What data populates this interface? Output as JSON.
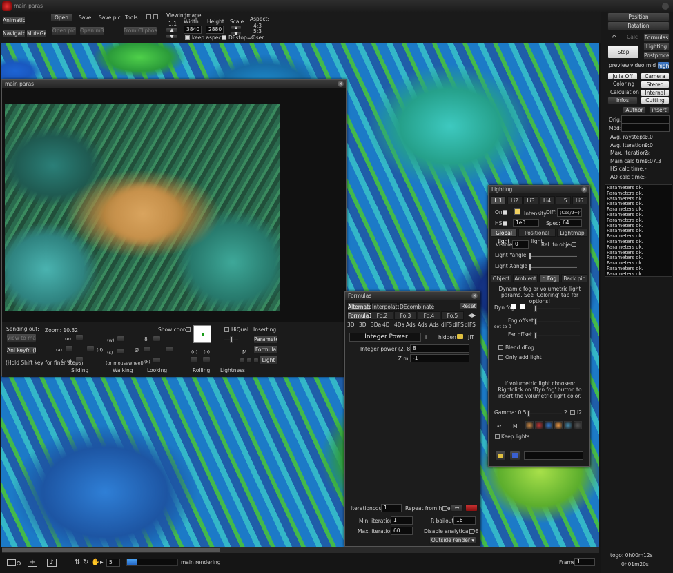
{
  "app_title": "main paras",
  "toolbar": {
    "animations": "Animations",
    "navigator": "Navigator",
    "mutagen": "MutaGen",
    "open": "Open",
    "save": "Save",
    "save_pic": "Save pic",
    "tools": "Tools",
    "open_pic": "Open pic",
    "open_m3p": "Open m3p",
    "from_clipboard": "From Clipboard",
    "viewing_label": "Viewing",
    "viewing_value": "1:1",
    "image_label": "Image",
    "width_label": "Width:",
    "width_value": "3840",
    "height_label": "Height:",
    "height_value": "2880",
    "scale_label": "Scale",
    "aspect_label": "Aspect:",
    "aspect_1": "4:3",
    "aspect_2": "5:3",
    "aspect_3": "user",
    "keep_aspect": "keep aspect",
    "destop": "DEstop=C"
  },
  "right_panel": {
    "position": "Position",
    "rotation": "Rotation",
    "calc": "Calc",
    "formulas": "Formulas",
    "stop": "Stop",
    "lighting": "Lighting",
    "postprocess": "Postprocess",
    "preview": "preview",
    "video": "video",
    "mid": "mid",
    "high": "high",
    "julia_off": "Julia Off",
    "camera": "Camera",
    "coloring": "Coloring",
    "stereo": "Stereo",
    "calculation": "Calculation",
    "internal": "Internal",
    "infos": "Infos",
    "cutting": "Cutting",
    "author": "Author",
    "insert": "insert",
    "orig": "Orig:",
    "mod": "Mod:",
    "stats": [
      {
        "label": "Avg. raysteps:",
        "value": "0.0"
      },
      {
        "label": "Avg. iterations:",
        "value": "0.0"
      },
      {
        "label": "Max. iterations:",
        "value": "?"
      },
      {
        "label": "Main calc time:",
        "value": "0.07.3"
      },
      {
        "label": "HS calc time:",
        "value": "-"
      },
      {
        "label": "AO calc time:",
        "value": "-"
      }
    ],
    "log_line": "Parameters ok.",
    "log_count": 17,
    "togo": "togo: 0h00m12s",
    "elapsed": "0h01m20s"
  },
  "main_paras": {
    "title": "main paras",
    "sending_out": "Sending out:",
    "view_to_main": "View to main",
    "ani_keyfr": "Ani keyfr. (f)",
    "hold_shift": "(Hold Shift key for finer steps)",
    "zoom": "Zoom: 10.32",
    "show_coords": "Show coords",
    "hiqual": "HiQual",
    "inserting": "Inserting:",
    "parameter": "Parameter",
    "formula": "Formula",
    "light": "Light",
    "sliding": "Sliding",
    "walking": "Walking",
    "looking": "Looking",
    "rolling": "Rolling",
    "lightness": "Lightness",
    "or_mousewheel": "(or mousewheel)",
    "keys": {
      "e": "(e)",
      "a": "(a)",
      "d": "(d)",
      "cq": "(c,q)",
      "w": "(w)",
      "s": "(s)",
      "k": "(k)",
      "u": "(u)",
      "o": "(o)",
      "m": "M"
    }
  },
  "formulas": {
    "title": "Formulas",
    "alternate": "Alternate",
    "interpolate": "Interpolate",
    "decombinate": "DEcombinate",
    "reset": "Reset",
    "tabs": [
      "Formula1",
      "Fo.2",
      "Fo.3",
      "Fo.4",
      "Fo.5"
    ],
    "dim_tabs": [
      "3D",
      "3D",
      "3Da",
      "4D",
      "4Da",
      "Ads",
      "Ads",
      "Ads",
      "dIFS",
      "dIFS",
      "dIFS"
    ],
    "formula_name": "Integer Power",
    "info": "i",
    "hidden": "hidden",
    "jit": "JIT",
    "params": [
      {
        "label": "Integer power (2, 8)",
        "value": "8"
      },
      {
        "label": "Z multiplier",
        "value": "-1"
      }
    ],
    "iterationcount": "Iterationcount",
    "iterationcount_value": "1",
    "repeat_from_here": "Repeat from here",
    "min_iter": "Min. iterations:",
    "min_iter_value": "1",
    "max_iter": "Max. iterations:",
    "max_iter_value": "60",
    "r_bailout": "R bailout:",
    "r_bailout_value": "16",
    "disable_de": "Disable analytical DE",
    "outside_render": "Outside render"
  },
  "lighting": {
    "title": "Lighting",
    "light_tabs": [
      "Li1",
      "Li2",
      "Li3",
      "Li4",
      "Li5",
      "Li6"
    ],
    "on": "On",
    "intensity": "Intensity",
    "diff": "Diff:",
    "diff_value": "(Cos/2+)^",
    "hs": "HS",
    "hs_value": "1e0",
    "spec": "Spec:",
    "spec_value": "64",
    "sub_tabs": [
      "Global light",
      "Positional light",
      "Lightmap"
    ],
    "visible": "Visible:",
    "visible_value": "0",
    "rel_to_object": "Rel. to object",
    "light_yangle": "Light Yangle",
    "light_xangle": "Light Xangle",
    "mode_tabs": [
      "Object",
      "Ambient",
      "d.Fog",
      "Back pic"
    ],
    "fog_desc": "Dynamic fog or volumetric light params. See 'Coloring' tab for options!",
    "dynfog": "Dyn.fog",
    "fog_offset": "Fog offset",
    "set_to_0": "set to 0",
    "far_offset": "Far offset",
    "blend_dfog": "Blend dFog",
    "only_add_light": "Only add light",
    "vol_desc": "If volumetric light choosen: Rightclick on 'Dyn.fog' button to insert the volumetric light color.",
    "gamma": "Gamma: 0.5",
    "gamma_2": "2",
    "i2": "I2",
    "m": "M",
    "keep_lights": "Keep lights"
  },
  "statusbar": {
    "steps_value": "5",
    "main_rendering": "main rendering",
    "frame": "Frame:",
    "frame_value": "1",
    "progress": 0.2
  },
  "colors": {
    "accent_blue": "#2f6fd0",
    "panel": "#1c1c1c",
    "bg": "#141414"
  }
}
